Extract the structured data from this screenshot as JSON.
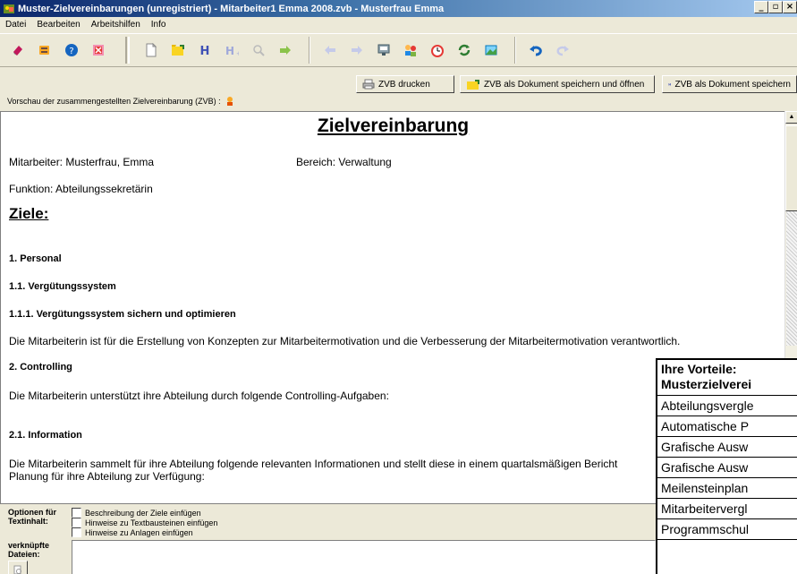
{
  "window": {
    "title": "Muster-Zielvereinbarungen (unregistriert) - Mitarbeiter1 Emma 2008.zvb - Musterfrau Emma",
    "minimize": "_",
    "maximize": "▫",
    "close": "×"
  },
  "menu": {
    "items": [
      "Datei",
      "Bearbeiten",
      "Arbeitshilfen",
      "Info"
    ]
  },
  "toolbar": {
    "icons": [
      "eraser-icon",
      "book-icon",
      "help-icon",
      "close-red-icon",
      "new-document-icon",
      "open-folder-icon",
      "save-h-icon",
      "save-h-plus-icon",
      "search-icon",
      "forward-arrow-icon",
      "back-arrow-icon",
      "forward-arrow-2-icon",
      "comment-icon",
      "people-icon",
      "clock-icon",
      "refresh-icon",
      "image-icon",
      "undo-icon",
      "redo-icon"
    ]
  },
  "actions": {
    "print": "ZVB drucken",
    "save_open": "ZVB als Dokument speichern und öffnen",
    "save": "ZVB als Dokument speichern"
  },
  "preview_label": "Vorschau der zusammengestellten Zielvereinbarung (ZVB) :",
  "document": {
    "title": "Zielvereinbarung",
    "employee": "Mitarbeiter: Musterfrau, Emma",
    "area": "Bereich: Verwaltung",
    "function": "Funktion: Abteilungssekretärin",
    "goals_heading": "Ziele:",
    "s1": "1. Personal",
    "s11": "1.1. Vergütungssystem",
    "s111": "1.1.1. Vergütungssystem sichern und optimieren",
    "p1": "Die Mitarbeiterin ist für die Erstellung von Konzepten zur Mitarbeitermotivation und die Verbesserung der Mitarbeitermotivation verantwortlich.",
    "s2": "2. Controlling",
    "p2": "Die Mitarbeiterin unterstützt ihre Abteilung durch folgende Controlling-Aufgaben:",
    "s21": "2.1. Information",
    "p3": "Die Mitarbeiterin sammelt für ihre Abteilung folgende relevanten Informationen und stellt diese in einem quartalsmäßigen Bericht",
    "p4": "Planung für ihre Abteilung zur Verfügung:"
  },
  "vorteile": {
    "heading1": "Ihre Vorteile:",
    "heading2": "Musterzielverei",
    "rows": [
      "Abteilungsvergle",
      "Automatische P",
      "Grafische Ausw",
      "Grafische Ausw",
      "Meilensteinplan",
      "Mitarbeitervergl",
      "Programmschul"
    ]
  },
  "options": {
    "label": "Optionen für Textinhalt:",
    "check1": "Beschreibung der Ziele einfügen",
    "check2": "Hinweise zu Textbausteinen einfügen",
    "check3": "Hinweise zu Anlagen einfügen",
    "files_label": "verknüpfte Dateien:"
  }
}
